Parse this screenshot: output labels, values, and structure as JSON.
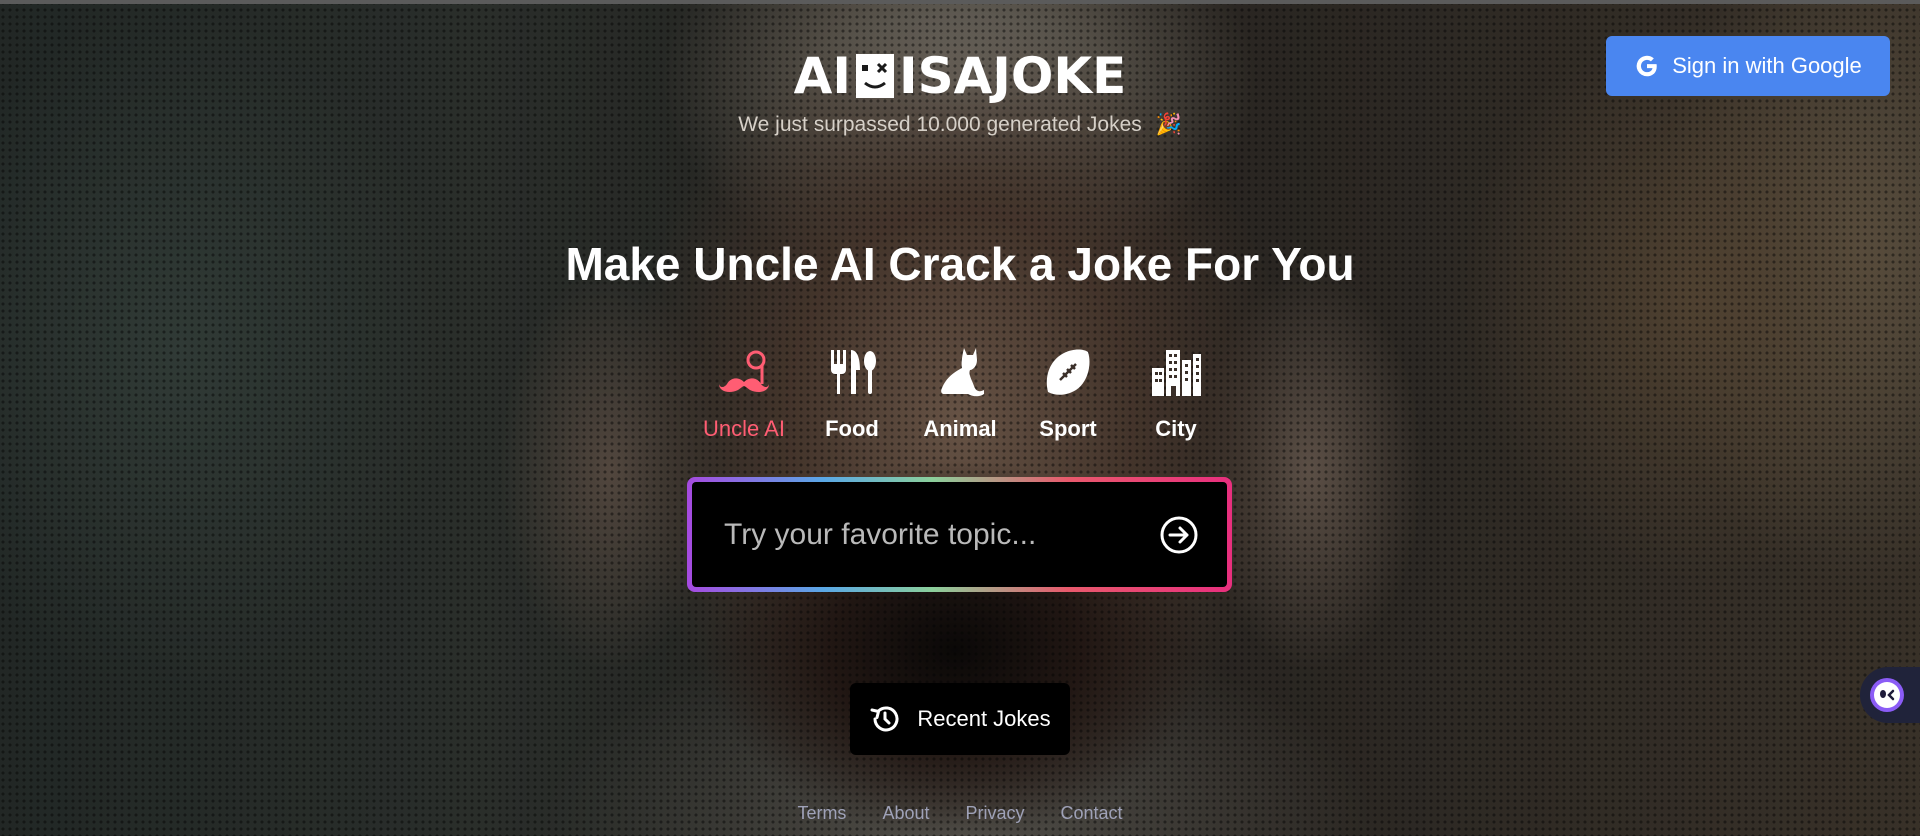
{
  "header": {
    "signin_label": "Sign in with Google",
    "logo_left": "AI",
    "logo_right": "ISAJOKE",
    "tagline": "We just surpassed 10.000 generated Jokes",
    "tagline_emoji": "🎉"
  },
  "main": {
    "headline": "Make Uncle AI Crack a Joke For You",
    "categories": [
      {
        "label": "Uncle AI",
        "icon": "mustache-monocle-icon",
        "active": true
      },
      {
        "label": "Food",
        "icon": "cutlery-icon",
        "active": false
      },
      {
        "label": "Animal",
        "icon": "cat-icon",
        "active": false
      },
      {
        "label": "Sport",
        "icon": "football-icon",
        "active": false
      },
      {
        "label": "City",
        "icon": "city-icon",
        "active": false
      }
    ],
    "search": {
      "placeholder": "Try your favorite topic...",
      "value": ""
    },
    "recent_label": "Recent Jokes"
  },
  "footer": {
    "links": [
      "Terms",
      "About",
      "Privacy",
      "Contact"
    ]
  },
  "colors": {
    "accent_blue": "#4a86f0",
    "active_category": "#ff5d73",
    "footer_link": "#9fa2b8"
  }
}
